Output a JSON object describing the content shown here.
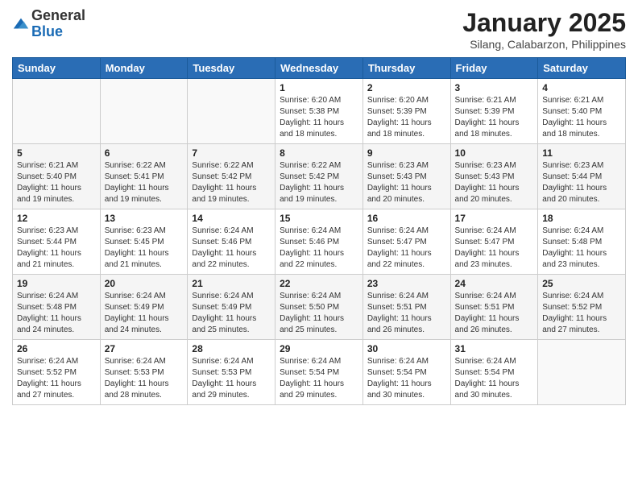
{
  "header": {
    "logo_general": "General",
    "logo_blue": "Blue",
    "main_title": "January 2025",
    "subtitle": "Silang, Calabarzon, Philippines"
  },
  "weekdays": [
    "Sunday",
    "Monday",
    "Tuesday",
    "Wednesday",
    "Thursday",
    "Friday",
    "Saturday"
  ],
  "weeks": [
    [
      {
        "day": "",
        "sunrise": "",
        "sunset": "",
        "daylight": ""
      },
      {
        "day": "",
        "sunrise": "",
        "sunset": "",
        "daylight": ""
      },
      {
        "day": "",
        "sunrise": "",
        "sunset": "",
        "daylight": ""
      },
      {
        "day": "1",
        "sunrise": "6:20 AM",
        "sunset": "5:38 PM",
        "daylight": "11 hours and 18 minutes."
      },
      {
        "day": "2",
        "sunrise": "6:20 AM",
        "sunset": "5:39 PM",
        "daylight": "11 hours and 18 minutes."
      },
      {
        "day": "3",
        "sunrise": "6:21 AM",
        "sunset": "5:39 PM",
        "daylight": "11 hours and 18 minutes."
      },
      {
        "day": "4",
        "sunrise": "6:21 AM",
        "sunset": "5:40 PM",
        "daylight": "11 hours and 18 minutes."
      }
    ],
    [
      {
        "day": "5",
        "sunrise": "6:21 AM",
        "sunset": "5:40 PM",
        "daylight": "11 hours and 19 minutes."
      },
      {
        "day": "6",
        "sunrise": "6:22 AM",
        "sunset": "5:41 PM",
        "daylight": "11 hours and 19 minutes."
      },
      {
        "day": "7",
        "sunrise": "6:22 AM",
        "sunset": "5:42 PM",
        "daylight": "11 hours and 19 minutes."
      },
      {
        "day": "8",
        "sunrise": "6:22 AM",
        "sunset": "5:42 PM",
        "daylight": "11 hours and 19 minutes."
      },
      {
        "day": "9",
        "sunrise": "6:23 AM",
        "sunset": "5:43 PM",
        "daylight": "11 hours and 20 minutes."
      },
      {
        "day": "10",
        "sunrise": "6:23 AM",
        "sunset": "5:43 PM",
        "daylight": "11 hours and 20 minutes."
      },
      {
        "day": "11",
        "sunrise": "6:23 AM",
        "sunset": "5:44 PM",
        "daylight": "11 hours and 20 minutes."
      }
    ],
    [
      {
        "day": "12",
        "sunrise": "6:23 AM",
        "sunset": "5:44 PM",
        "daylight": "11 hours and 21 minutes."
      },
      {
        "day": "13",
        "sunrise": "6:23 AM",
        "sunset": "5:45 PM",
        "daylight": "11 hours and 21 minutes."
      },
      {
        "day": "14",
        "sunrise": "6:24 AM",
        "sunset": "5:46 PM",
        "daylight": "11 hours and 22 minutes."
      },
      {
        "day": "15",
        "sunrise": "6:24 AM",
        "sunset": "5:46 PM",
        "daylight": "11 hours and 22 minutes."
      },
      {
        "day": "16",
        "sunrise": "6:24 AM",
        "sunset": "5:47 PM",
        "daylight": "11 hours and 22 minutes."
      },
      {
        "day": "17",
        "sunrise": "6:24 AM",
        "sunset": "5:47 PM",
        "daylight": "11 hours and 23 minutes."
      },
      {
        "day": "18",
        "sunrise": "6:24 AM",
        "sunset": "5:48 PM",
        "daylight": "11 hours and 23 minutes."
      }
    ],
    [
      {
        "day": "19",
        "sunrise": "6:24 AM",
        "sunset": "5:48 PM",
        "daylight": "11 hours and 24 minutes."
      },
      {
        "day": "20",
        "sunrise": "6:24 AM",
        "sunset": "5:49 PM",
        "daylight": "11 hours and 24 minutes."
      },
      {
        "day": "21",
        "sunrise": "6:24 AM",
        "sunset": "5:49 PM",
        "daylight": "11 hours and 25 minutes."
      },
      {
        "day": "22",
        "sunrise": "6:24 AM",
        "sunset": "5:50 PM",
        "daylight": "11 hours and 25 minutes."
      },
      {
        "day": "23",
        "sunrise": "6:24 AM",
        "sunset": "5:51 PM",
        "daylight": "11 hours and 26 minutes."
      },
      {
        "day": "24",
        "sunrise": "6:24 AM",
        "sunset": "5:51 PM",
        "daylight": "11 hours and 26 minutes."
      },
      {
        "day": "25",
        "sunrise": "6:24 AM",
        "sunset": "5:52 PM",
        "daylight": "11 hours and 27 minutes."
      }
    ],
    [
      {
        "day": "26",
        "sunrise": "6:24 AM",
        "sunset": "5:52 PM",
        "daylight": "11 hours and 27 minutes."
      },
      {
        "day": "27",
        "sunrise": "6:24 AM",
        "sunset": "5:53 PM",
        "daylight": "11 hours and 28 minutes."
      },
      {
        "day": "28",
        "sunrise": "6:24 AM",
        "sunset": "5:53 PM",
        "daylight": "11 hours and 29 minutes."
      },
      {
        "day": "29",
        "sunrise": "6:24 AM",
        "sunset": "5:54 PM",
        "daylight": "11 hours and 29 minutes."
      },
      {
        "day": "30",
        "sunrise": "6:24 AM",
        "sunset": "5:54 PM",
        "daylight": "11 hours and 30 minutes."
      },
      {
        "day": "31",
        "sunrise": "6:24 AM",
        "sunset": "5:54 PM",
        "daylight": "11 hours and 30 minutes."
      },
      {
        "day": "",
        "sunrise": "",
        "sunset": "",
        "daylight": ""
      }
    ]
  ]
}
